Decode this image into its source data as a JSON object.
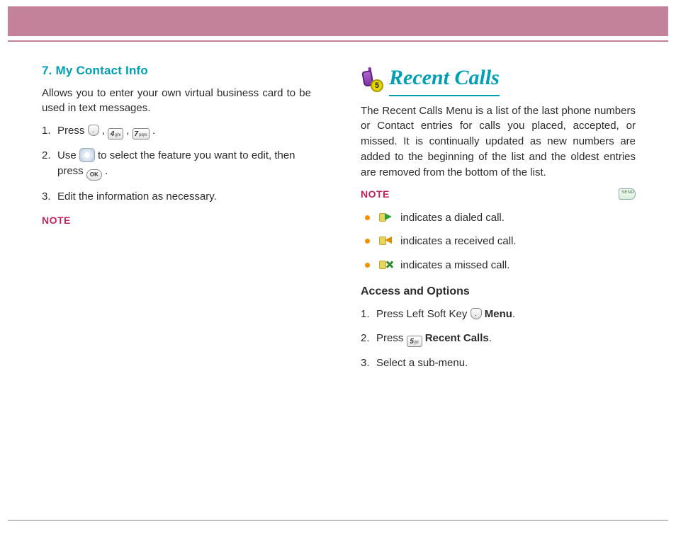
{
  "left": {
    "heading": "7. My Contact Info",
    "intro": "Allows you to enter your own virtual business card to be used in text messages.",
    "steps": {
      "s1a": "Press ",
      "s1b": " , ",
      "s1c": " , ",
      "s1d": " .",
      "s2a": "Use ",
      "s2b": " to select the feature you want to edit, then",
      "s2c": "press ",
      "s2d": " .",
      "s3": "Edit the information as necessary."
    },
    "note_label": "NOTE"
  },
  "right": {
    "title": "Recent Calls",
    "badge": "5",
    "intro": "The Recent Calls Menu is a list of the last phone numbers or Contact entries for calls you placed, accepted, or missed. It is continually updated as new numbers are added to the beginning of the list and the oldest entries are removed from the bottom of the list.",
    "note_label": "NOTE",
    "calltypes": {
      "dialed": " indicates a dialed call.",
      "received": " indicates a received call.",
      "missed": " indicates a missed call."
    },
    "access_heading": "Access and Options",
    "steps": {
      "s1a": "Press Left Soft Key ",
      "s1b": "Menu",
      "s1c": ".",
      "s2a": "Press ",
      "s2b": "Recent Calls",
      "s2c": ".",
      "s3": "Select a sub-menu."
    }
  },
  "keys": {
    "k4": {
      "d": "4",
      "l": "ghi"
    },
    "k5": {
      "d": "5",
      "l": "jkl"
    },
    "k7": {
      "d": "7",
      "l": "pqrs"
    },
    "ok": "OK"
  }
}
